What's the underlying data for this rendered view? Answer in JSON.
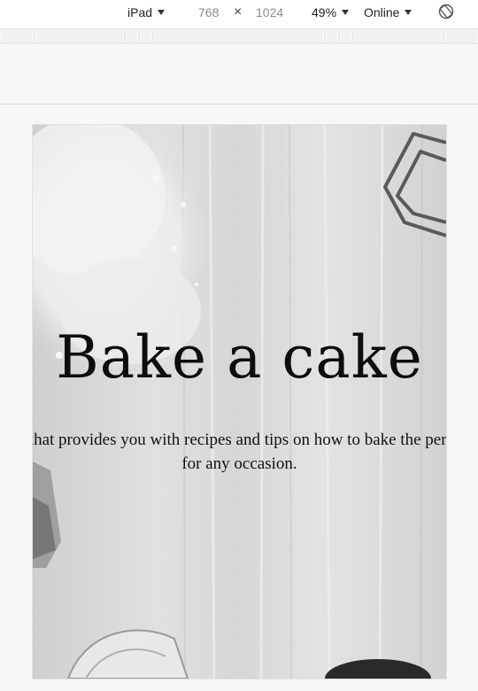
{
  "toolbar": {
    "device": "iPad",
    "width": "768",
    "times": "×",
    "height": "1024",
    "zoom": "49%",
    "throttle": "Online"
  },
  "hero": {
    "title": "Bake a cake",
    "subtitle": "A guide that provides you with recipes and tips on how to bake the perfect cake for any occasion."
  },
  "colors": {
    "page_bg": "#f7f7f7",
    "hero_bg": "#d9d9d9",
    "text": "#111111"
  },
  "icons": {
    "rotate": "rotate-icon",
    "dropdown": "caret-down-icon"
  }
}
